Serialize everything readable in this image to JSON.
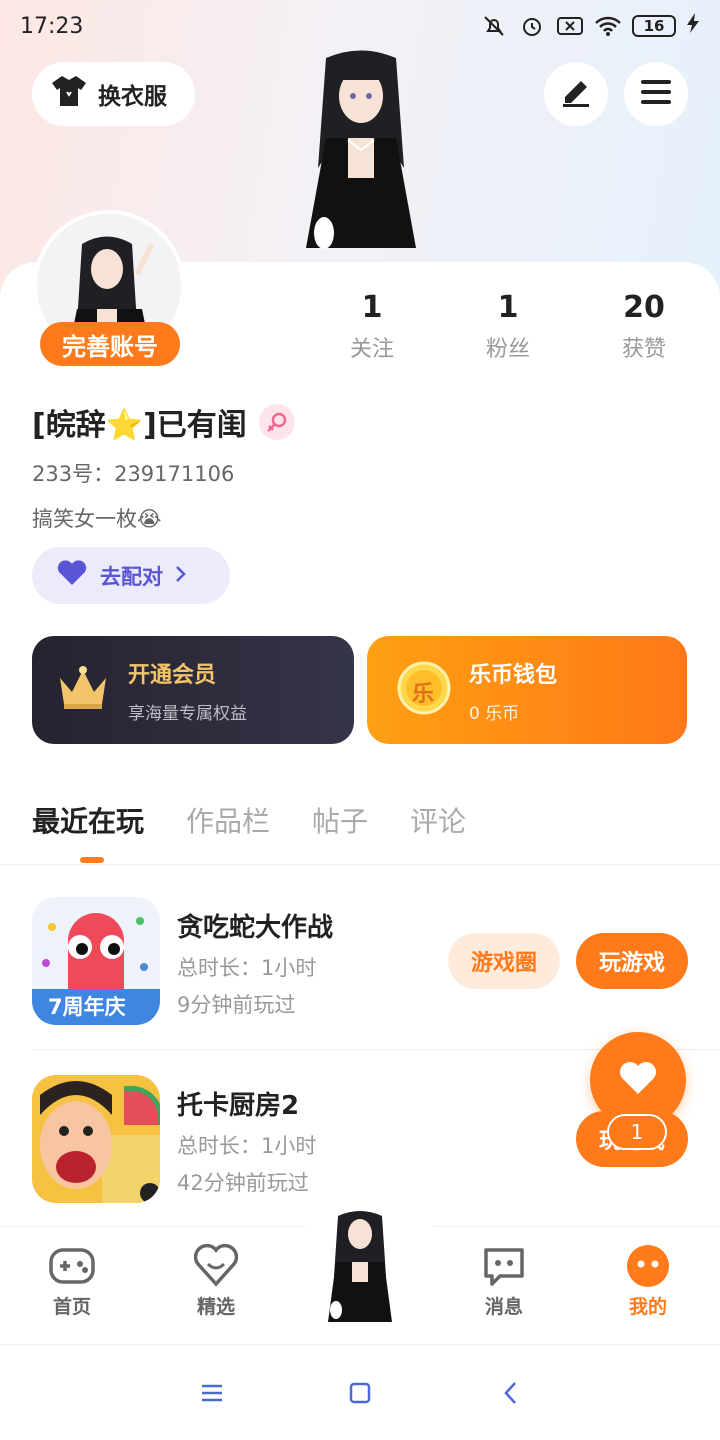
{
  "status_bar": {
    "time": "17:23",
    "battery": "16"
  },
  "header": {
    "outfit_label": "换衣服"
  },
  "profile": {
    "complete_label": "完善账号",
    "username": "[皖辞⭐]已有闺",
    "uid": "233号：239171106",
    "bio": "搞笑女一枚😭",
    "match_label": "去配对",
    "stats": [
      {
        "value": "1",
        "label": "关注"
      },
      {
        "value": "1",
        "label": "粉丝"
      },
      {
        "value": "20",
        "label": "获赞"
      }
    ]
  },
  "vip": {
    "title": "开通会员",
    "subtitle": "享海量专属权益"
  },
  "wallet": {
    "title": "乐币钱包",
    "subtitle": "0 乐币",
    "coin_char": "乐"
  },
  "tabs": [
    "最近在玩",
    "作品栏",
    "帖子",
    "评论"
  ],
  "games": [
    {
      "name": "贪吃蛇大作战",
      "duration": "总时长：1小时",
      "last_played": "9分钟前玩过",
      "circle_label": "游戏圈",
      "play_label": "玩游戏",
      "badge": "7周年庆"
    },
    {
      "name": "托卡厨房2",
      "duration": "总时长：1小时",
      "last_played": "42分钟前玩过",
      "play_label": "玩游戏"
    }
  ],
  "fab": {
    "count": "1"
  },
  "bottom_nav": [
    {
      "label": "首页"
    },
    {
      "label": "精选"
    },
    {
      "label": "消息"
    },
    {
      "label": "我的"
    }
  ],
  "colors": {
    "accent": "#ff7a1a",
    "match": "#5a55d6",
    "vip_bg": "#25232f"
  }
}
